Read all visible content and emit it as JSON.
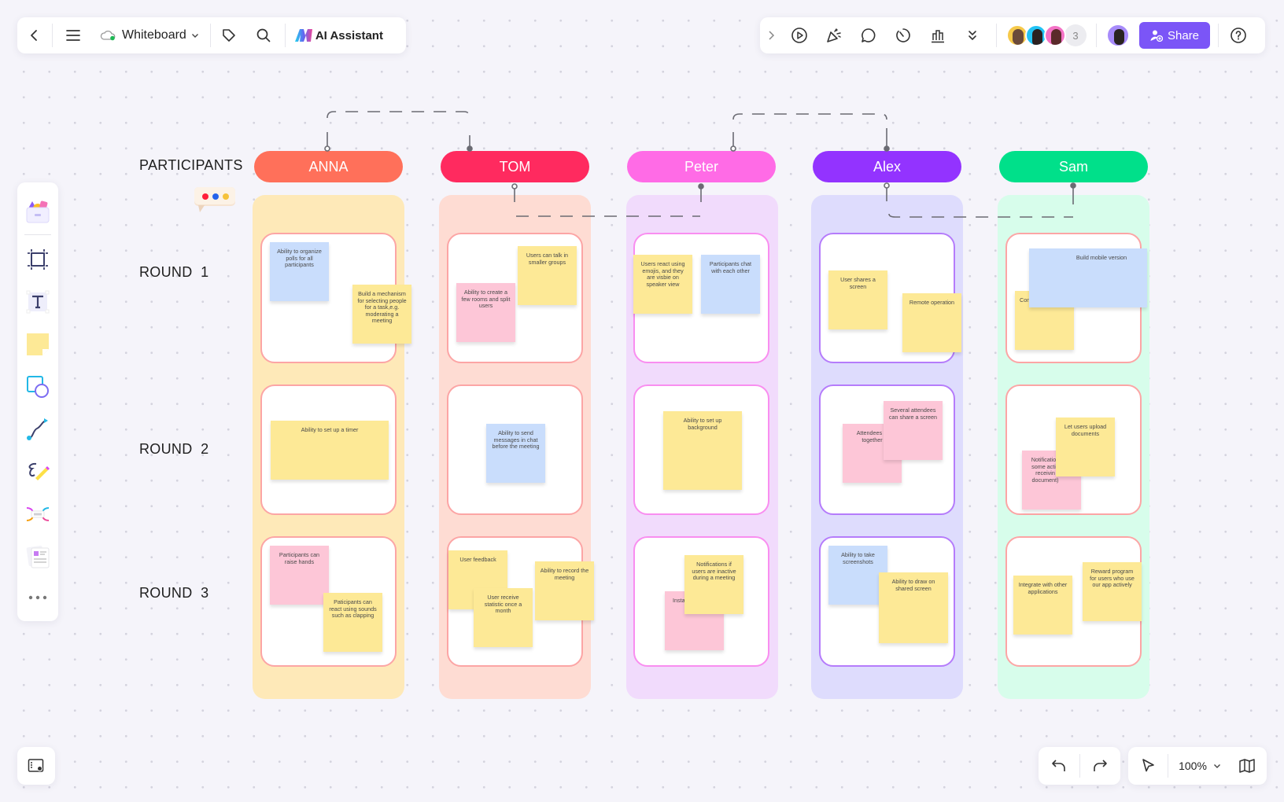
{
  "topbar": {
    "back_icon": "chevron-left-icon",
    "menu_icon": "hamburger-icon",
    "doc_title": "Whiteboard",
    "cloud_status_icon": "cloud-synced-icon",
    "tag_icon": "tag-icon",
    "search_icon": "search-icon",
    "ai_label": "AI Assistant"
  },
  "topbar_right": {
    "tools": [
      "expand-icon",
      "present-icon",
      "celebrate-icon",
      "comment-icon",
      "timer-icon",
      "vote-icon",
      "more-double-chevron-icon"
    ],
    "collaborators_extra_count": "3",
    "share_label": "Share",
    "help_icon": "help-icon"
  },
  "left_toolbar": {
    "items": [
      "templates",
      "frame",
      "text",
      "sticky-note",
      "shapes",
      "connector",
      "pen",
      "mindmap",
      "document",
      "more"
    ]
  },
  "bottom": {
    "zoom_level": "100%"
  },
  "board": {
    "participants_label": "PARTICIPANTS",
    "rounds": [
      "ROUND  1",
      "ROUND  2",
      "ROUND  3"
    ],
    "participants": [
      {
        "name": "ANNA",
        "pill_color": "#ff705a",
        "lane_color": "#fee9b8",
        "card_border": "#fca5a5"
      },
      {
        "name": "TOM",
        "pill_color": "#ff2a5f",
        "lane_color": "#fedcd3",
        "card_border": "#fca5a5"
      },
      {
        "name": "Peter",
        "pill_color": "#ff6be6",
        "lane_color": "#f1dbfc",
        "card_border": "#f98ef0"
      },
      {
        "name": "Alex",
        "pill_color": "#9333ff",
        "lane_color": "#dedcfd",
        "card_border": "#b57cfb"
      },
      {
        "name": "Sam",
        "pill_color": "#00e08a",
        "lane_color": "#d7fdeb",
        "card_border": "#fca5a5"
      }
    ],
    "notes": {
      "anna_r1": [
        "Ability to organize polls for all participants",
        "Build a mechanism for selecting people for a task,e.g. moderating a meeting"
      ],
      "anna_r2": [
        "Ability to set up a timer"
      ],
      "anna_r3": [
        "Participants can raise hands",
        "Paticipants can react using sounds such as clapping"
      ],
      "tom_r1": [
        "Users can talk in smaller groups",
        "Ability to create a few rooms and split users"
      ],
      "tom_r2": [
        "Ability to send messages in chat before the meeting"
      ],
      "tom_r3": [
        "User feedback",
        "User receive statistic once a month",
        "Ability to record the meeting"
      ],
      "peter_r1": [
        "Users react using emojis, and they are visbie on speaker view",
        "Participants chat with each other"
      ],
      "peter_r2": [
        "Ability to set up background"
      ],
      "peter_r3": [
        "Insta",
        "Notifications if users are inactive during a meeting"
      ],
      "alex_r1": [
        "User shares a screen",
        "Remote operation"
      ],
      "alex_r2": [
        "Attendees w together",
        "Several attendees can share a screen"
      ],
      "alex_r3": [
        "Ability to take screenshots",
        "Ability to draw on shared screen"
      ],
      "sam_r1": [
        "Con",
        "Build mobile version"
      ],
      "sam_r2": [
        "Notification some actio receivin document)",
        "Let users upload documents"
      ],
      "sam_r3": [
        "Integrate with other applications",
        "Reward program for users who use our app actively"
      ]
    }
  }
}
